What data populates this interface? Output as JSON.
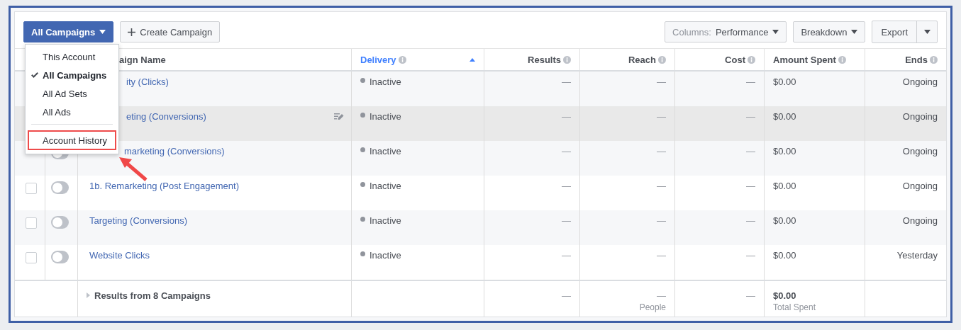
{
  "toolbar": {
    "level_button": "All Campaigns",
    "create_button": "Create Campaign",
    "columns_button": {
      "prefix": "Columns:",
      "value": "Performance"
    },
    "breakdown_button": "Breakdown",
    "export_button": "Export"
  },
  "level_menu": {
    "items": [
      {
        "label": "This Account",
        "checked": false,
        "highlighted": false
      },
      {
        "label": "All Campaigns",
        "checked": true,
        "highlighted": false
      },
      {
        "label": "All Ad Sets",
        "checked": false,
        "highlighted": false
      },
      {
        "label": "All Ads",
        "checked": false,
        "highlighted": false
      },
      {
        "label": "Account History",
        "checked": false,
        "highlighted": true
      }
    ]
  },
  "table": {
    "columns": [
      {
        "label": "aign Name",
        "sorted": false,
        "info": false
      },
      {
        "label": "Delivery",
        "sorted": true,
        "info": true
      },
      {
        "label": "Results",
        "sorted": false,
        "info": true
      },
      {
        "label": "Reach",
        "sorted": false,
        "info": true
      },
      {
        "label": "Cost",
        "sorted": false,
        "info": true
      },
      {
        "label": "Amount Spent",
        "sorted": false,
        "info": true
      },
      {
        "label": "Ends",
        "sorted": false,
        "info": true
      }
    ],
    "rows": [
      {
        "name": "ity (Clicks)",
        "covered": true,
        "hovered": false,
        "delivery": "Inactive",
        "results": "—",
        "reach": "—",
        "cost": "—",
        "amount": "$0.00",
        "ends": "Ongoing"
      },
      {
        "name": "eting (Conversions)",
        "covered": true,
        "hovered": true,
        "delivery": "Inactive",
        "results": "—",
        "reach": "—",
        "cost": "—",
        "amount": "$0.00",
        "ends": "Ongoing"
      },
      {
        "name": "marketing (Conversions)",
        "covered": true,
        "hovered": false,
        "on": false,
        "delivery": "Inactive",
        "results": "—",
        "reach": "—",
        "cost": "—",
        "amount": "$0.00",
        "ends": "Ongoing"
      },
      {
        "name": "1b. Remarketing (Post Engagement)",
        "covered": false,
        "hovered": false,
        "on": false,
        "delivery": "Inactive",
        "results": "—",
        "reach": "—",
        "cost": "—",
        "amount": "$0.00",
        "ends": "Ongoing"
      },
      {
        "name": "Targeting (Conversions)",
        "covered": false,
        "hovered": false,
        "on": false,
        "delivery": "Inactive",
        "results": "—",
        "reach": "—",
        "cost": "—",
        "amount": "$0.00",
        "ends": "Ongoing"
      },
      {
        "name": "Website Clicks",
        "covered": false,
        "hovered": false,
        "on": false,
        "delivery": "Inactive",
        "results": "—",
        "reach": "—",
        "cost": "—",
        "amount": "$0.00",
        "ends": "Yesterday"
      }
    ],
    "footer": {
      "label": "Results from 8 Campaigns",
      "results": "—",
      "reach": "—",
      "reach_note": "People",
      "cost": "—",
      "amount": "$0.00",
      "amount_note": "Total Spent"
    }
  }
}
